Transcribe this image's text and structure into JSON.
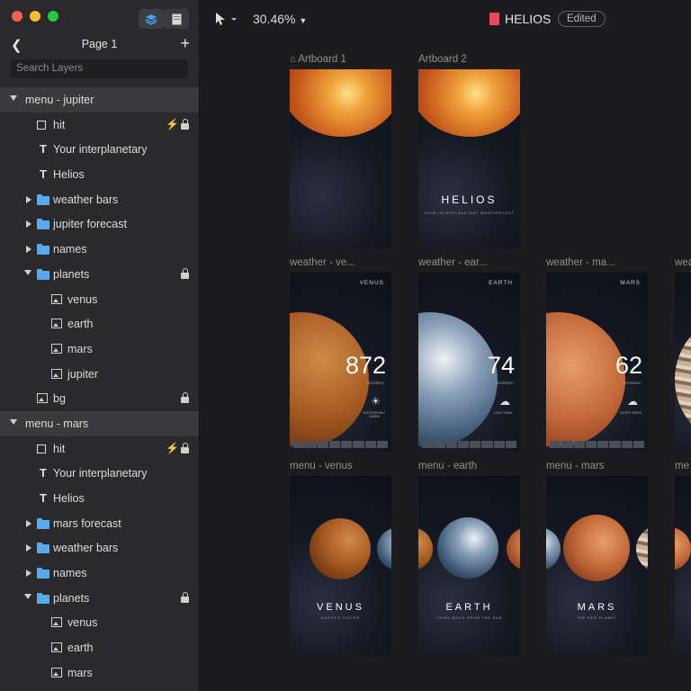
{
  "page": {
    "title": "Page 1"
  },
  "search": {
    "placeholder": "Search Layers"
  },
  "layers": [
    {
      "label": "menu - jupiter",
      "type": "group",
      "depth": 0,
      "expanded": true
    },
    {
      "label": "hit",
      "type": "rect",
      "depth": 1,
      "bolt": true,
      "locked": true
    },
    {
      "label": "Your interplanetary",
      "type": "text",
      "depth": 1
    },
    {
      "label": "Helios",
      "type": "text",
      "depth": 1
    },
    {
      "label": "weather bars",
      "type": "folder",
      "depth": 1,
      "expanded": false
    },
    {
      "label": "jupiter forecast",
      "type": "folder",
      "depth": 1,
      "expanded": false
    },
    {
      "label": "names",
      "type": "folder",
      "depth": 1,
      "expanded": false
    },
    {
      "label": "planets",
      "type": "folder",
      "depth": 1,
      "expanded": true,
      "locked": true
    },
    {
      "label": "venus",
      "type": "image",
      "depth": 2
    },
    {
      "label": "earth",
      "type": "image",
      "depth": 2
    },
    {
      "label": "mars",
      "type": "image",
      "depth": 2
    },
    {
      "label": "jupiter",
      "type": "image",
      "depth": 2
    },
    {
      "label": "bg",
      "type": "image",
      "depth": 1,
      "locked": true
    },
    {
      "label": "menu - mars",
      "type": "group",
      "depth": 0,
      "expanded": true
    },
    {
      "label": "hit",
      "type": "rect",
      "depth": 1,
      "bolt": true,
      "locked": true
    },
    {
      "label": "Your interplanetary",
      "type": "text",
      "depth": 1
    },
    {
      "label": "Helios",
      "type": "text",
      "depth": 1
    },
    {
      "label": "mars forecast",
      "type": "folder",
      "depth": 1,
      "expanded": false
    },
    {
      "label": "weather bars",
      "type": "folder",
      "depth": 1,
      "expanded": false
    },
    {
      "label": "names",
      "type": "folder",
      "depth": 1,
      "expanded": false
    },
    {
      "label": "planets",
      "type": "folder",
      "depth": 1,
      "expanded": true,
      "locked": true
    },
    {
      "label": "venus",
      "type": "image",
      "depth": 2
    },
    {
      "label": "earth",
      "type": "image",
      "depth": 2
    },
    {
      "label": "mars",
      "type": "image",
      "depth": 2
    }
  ],
  "toolbar": {
    "zoom": "30.46%",
    "doc_title": "HELIOS",
    "status": "Edited"
  },
  "artboards": {
    "row1": [
      {
        "label": "Artboard 1",
        "home": true
      },
      {
        "label": "Artboard 2",
        "title": "HELIOS",
        "subtitle": "YOUR INTERPLANETARY WEATHERCAST"
      }
    ],
    "row2": [
      {
        "label": "weather - ve...",
        "planet": "VENUS",
        "value": "872",
        "unit": "DEGREES",
        "desc": "EXCESSIVELY WARM"
      },
      {
        "label": "weather - ear...",
        "planet": "EARTH",
        "value": "74",
        "unit": "DEGREES",
        "desc": "LIGHT RAIN"
      },
      {
        "label": "weather - ma...",
        "planet": "MARS",
        "value": "62",
        "unit": "DEGREES",
        "desc": "DUSTY SKIES"
      },
      {
        "label": "wea"
      }
    ],
    "row3": [
      {
        "label": "menu - venus",
        "name": "VENUS",
        "sub": "EARTH'S SISTER"
      },
      {
        "label": "menu - earth",
        "name": "EARTH",
        "sub": "THIRD ROCK FROM THE SUN"
      },
      {
        "label": "menu - mars",
        "name": "MARS",
        "sub": "THE RED PLANET"
      },
      {
        "label": "me"
      }
    ]
  }
}
